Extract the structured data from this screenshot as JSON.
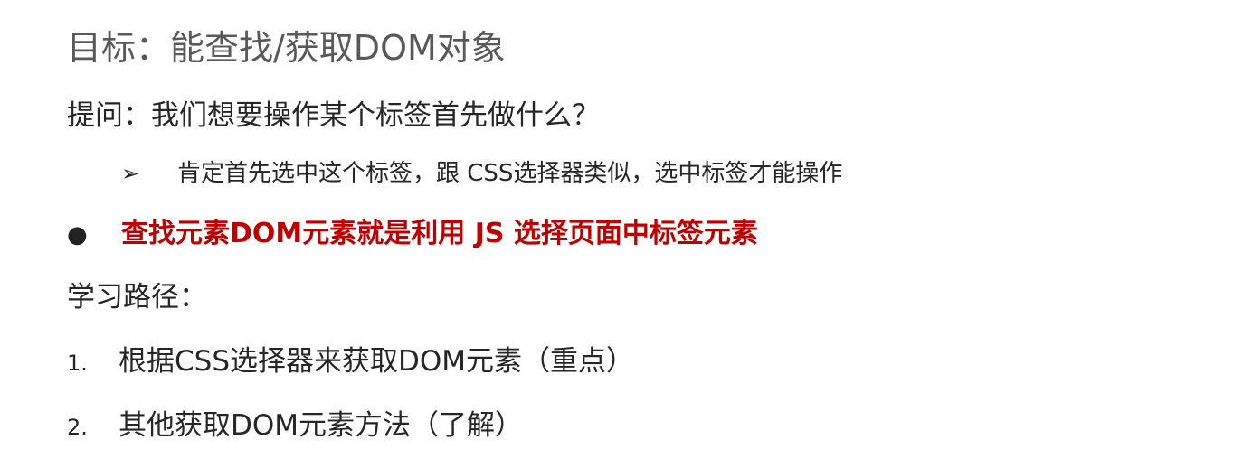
{
  "title": "目标：能查找/获取DOM对象",
  "question": "提问：我们想要操作某个标签首先做什么？",
  "sub_point": {
    "marker": "➢",
    "text": "肯定首先选中这个标签，跟 CSS选择器类似，选中标签才能操作"
  },
  "emphasis": {
    "marker": "●",
    "text": "查找元素DOM元素就是利用 JS 选择页面中标签元素"
  },
  "path_label": "学习路径：",
  "steps": [
    {
      "num": "1.",
      "text": "根据CSS选择器来获取DOM元素（重点）"
    },
    {
      "num": "2.",
      "text": "其他获取DOM元素方法（了解）"
    }
  ],
  "colors": {
    "title": "#595959",
    "body": "#262626",
    "emphasis": "#c00000"
  }
}
